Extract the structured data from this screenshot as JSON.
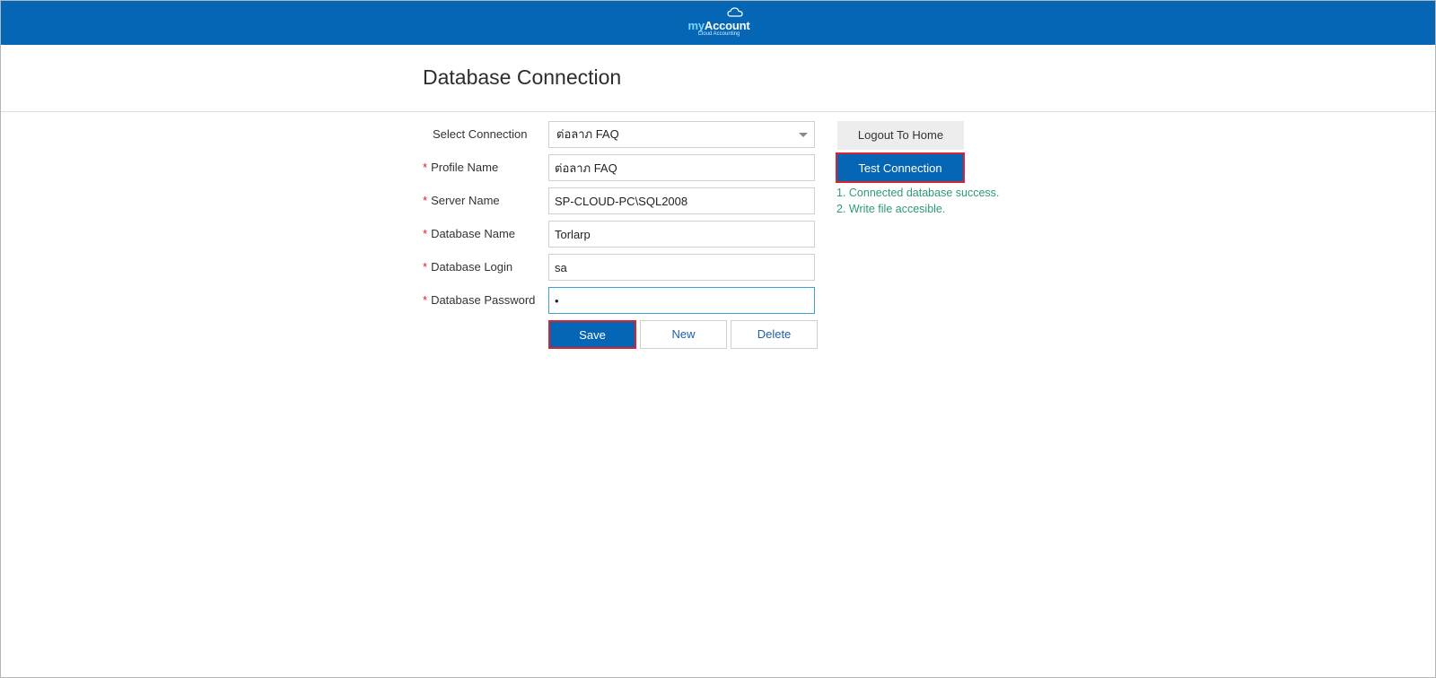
{
  "header": {
    "logo_my": "my",
    "logo_account": "Account",
    "logo_sub": "Cloud Accounting"
  },
  "page": {
    "title": "Database Connection"
  },
  "form": {
    "select_connection": {
      "label": "Select Connection",
      "value": "ต่อลาภ FAQ"
    },
    "profile_name": {
      "label": "Profile Name",
      "value": "ต่อลาภ FAQ"
    },
    "server_name": {
      "label": "Server Name",
      "value": "SP-CLOUD-PC\\SQL2008"
    },
    "database_name": {
      "label": "Database Name",
      "value": "Torlarp"
    },
    "database_login": {
      "label": "Database Login",
      "value": "sa"
    },
    "database_password": {
      "label": "Database Password",
      "value": "•"
    },
    "required_marker": "*"
  },
  "actions": {
    "save": "Save",
    "new": "New",
    "delete": "Delete",
    "logout": "Logout To Home",
    "test": "Test Connection"
  },
  "status": {
    "messages": [
      "1. Connected database success.",
      "2. Write file accesible."
    ],
    "color": "#2d9a7a"
  },
  "colors": {
    "brand": "#0466b4",
    "highlight": "#d9232e"
  }
}
